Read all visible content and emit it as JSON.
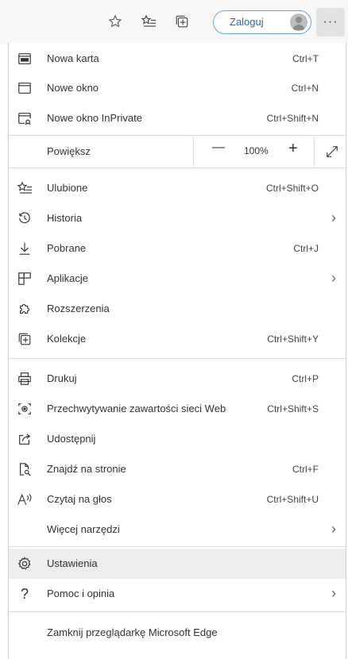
{
  "toolbar": {
    "sign_in_label": "Zaloguj",
    "more_label": "···"
  },
  "menu": {
    "new_tab": {
      "label": "Nowa karta",
      "shortcut": "Ctrl+T"
    },
    "new_window": {
      "label": "Nowe okno",
      "shortcut": "Ctrl+N"
    },
    "new_inprivate": {
      "label": "Nowe okno InPrivate",
      "shortcut": "Ctrl+Shift+N"
    },
    "zoom": {
      "label": "Powiększ",
      "minus": "—",
      "value": "100%",
      "plus": "+"
    },
    "favorites": {
      "label": "Ulubione",
      "shortcut": "Ctrl+Shift+O"
    },
    "history": {
      "label": "Historia"
    },
    "downloads": {
      "label": "Pobrane",
      "shortcut": "Ctrl+J"
    },
    "apps": {
      "label": "Aplikacje"
    },
    "extensions": {
      "label": "Rozszerzenia"
    },
    "collections": {
      "label": "Kolekcje",
      "shortcut": "Ctrl+Shift+Y"
    },
    "print": {
      "label": "Drukuj",
      "shortcut": "Ctrl+P"
    },
    "web_capture": {
      "label": "Przechwytywanie zawartości sieci Web",
      "shortcut": "Ctrl+Shift+S"
    },
    "share": {
      "label": "Udostępnij"
    },
    "find": {
      "label": "Znajdź na stronie",
      "shortcut": "Ctrl+F"
    },
    "read_aloud": {
      "label": "Czytaj na głos",
      "shortcut": "Ctrl+Shift+U"
    },
    "more_tools": {
      "label": "Więcej narzędzi"
    },
    "settings": {
      "label": "Ustawienia"
    },
    "help": {
      "label": "Pomoc i opinia"
    },
    "close_edge": {
      "label": "Zamknij przeglądarkę Microsoft Edge"
    }
  }
}
